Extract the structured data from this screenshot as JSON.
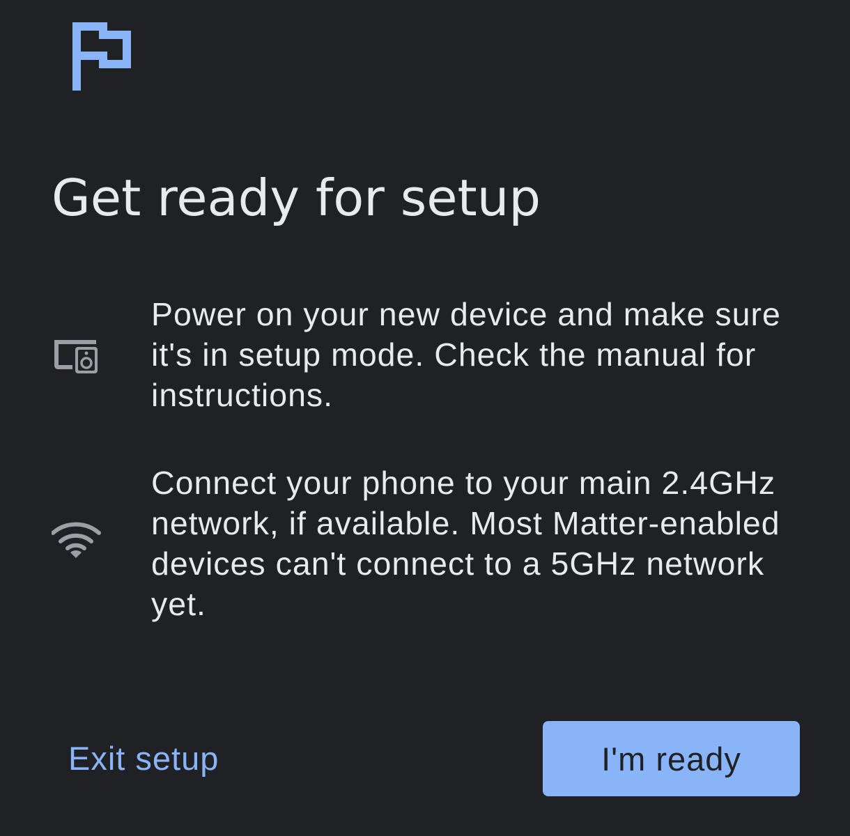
{
  "header": {
    "icon": "flag-icon",
    "accent_color": "#8ab4f8"
  },
  "page": {
    "title": "Get ready for setup",
    "background_color": "#202124"
  },
  "steps": [
    {
      "icon": "device-speaker-icon",
      "text": "Power on your new device and make sure it's in setup mode. Check the manual for instructions."
    },
    {
      "icon": "wifi-icon",
      "text": "Connect your phone to your main 2.4GHz network, if available. Most Matter-enabled devices can't connect to a 5GHz network yet."
    }
  ],
  "actions": {
    "exit_label": "Exit setup",
    "ready_label": "I'm ready",
    "primary_color": "#8ab4f8"
  }
}
